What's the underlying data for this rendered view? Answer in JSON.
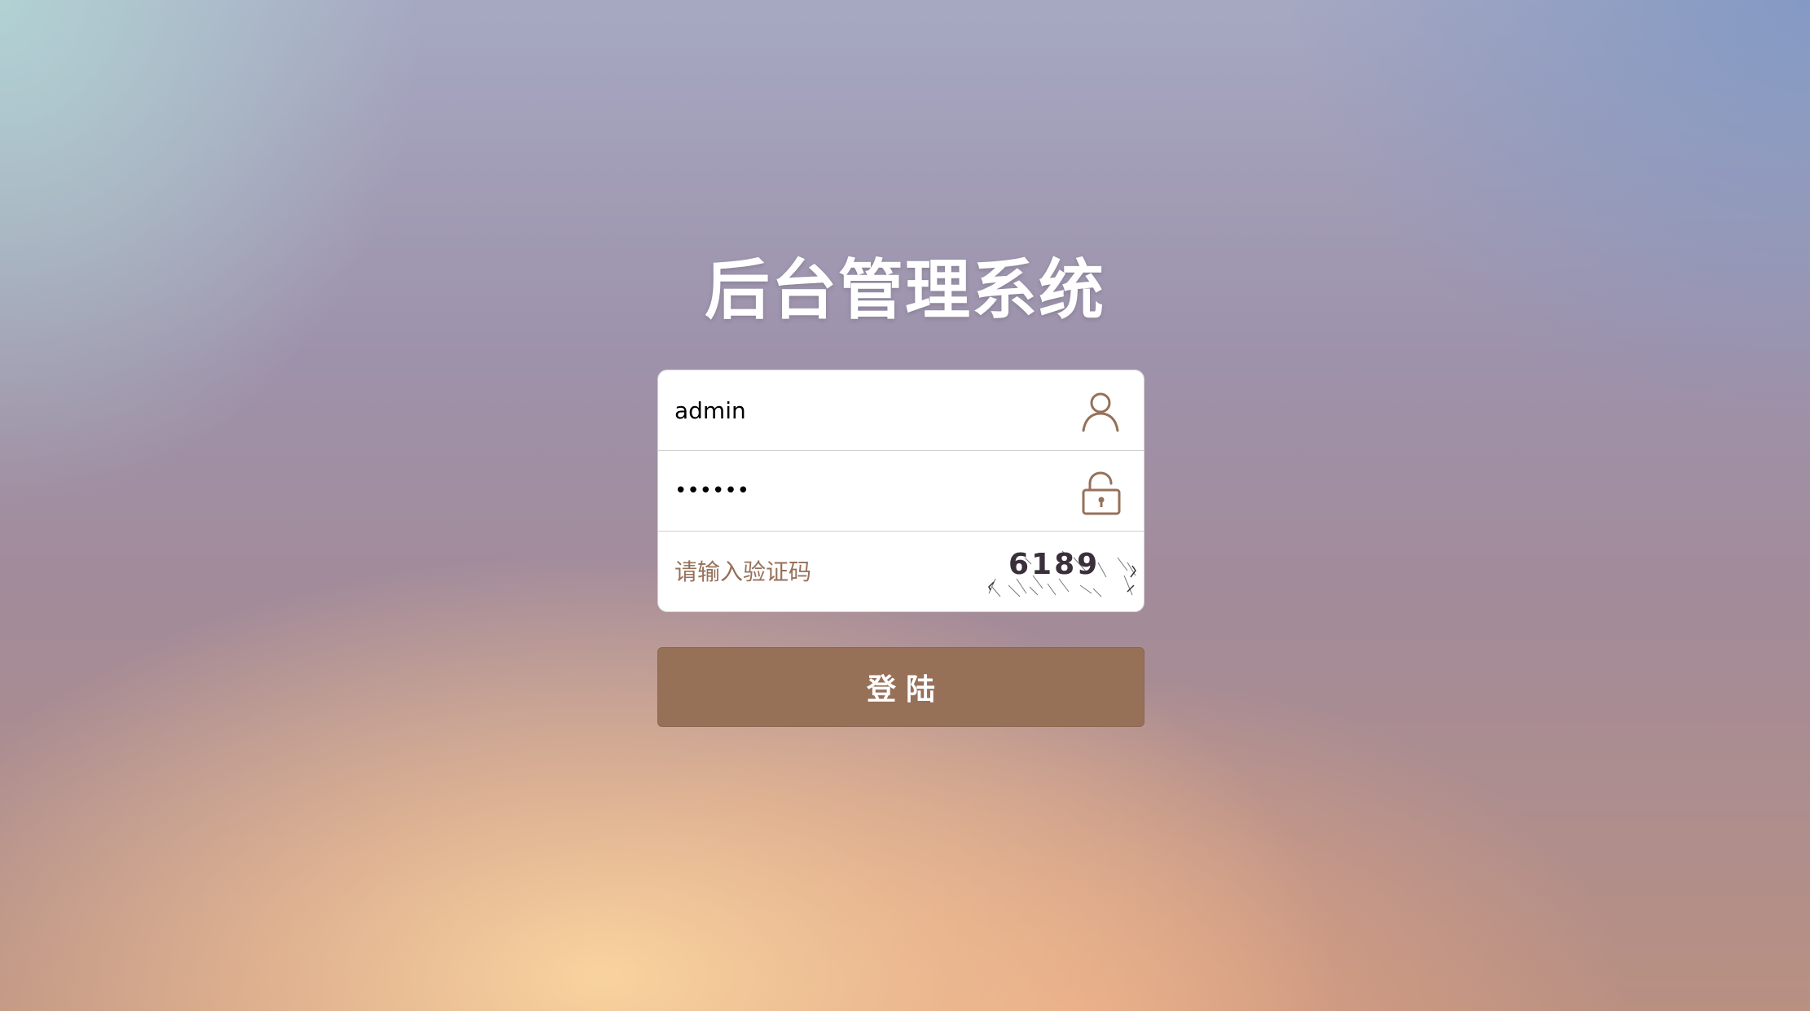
{
  "page": {
    "title": "后台管理系统"
  },
  "form": {
    "username": {
      "value": "admin",
      "icon": "user-icon"
    },
    "password": {
      "value": "••••••",
      "icon": "unlock-icon"
    },
    "captcha": {
      "placeholder": "请输入验证码",
      "code": "6189"
    }
  },
  "login_button": {
    "label": "登陆"
  },
  "colors": {
    "accent": "#977058",
    "icon": "#96715a",
    "title": "#ffffff"
  }
}
